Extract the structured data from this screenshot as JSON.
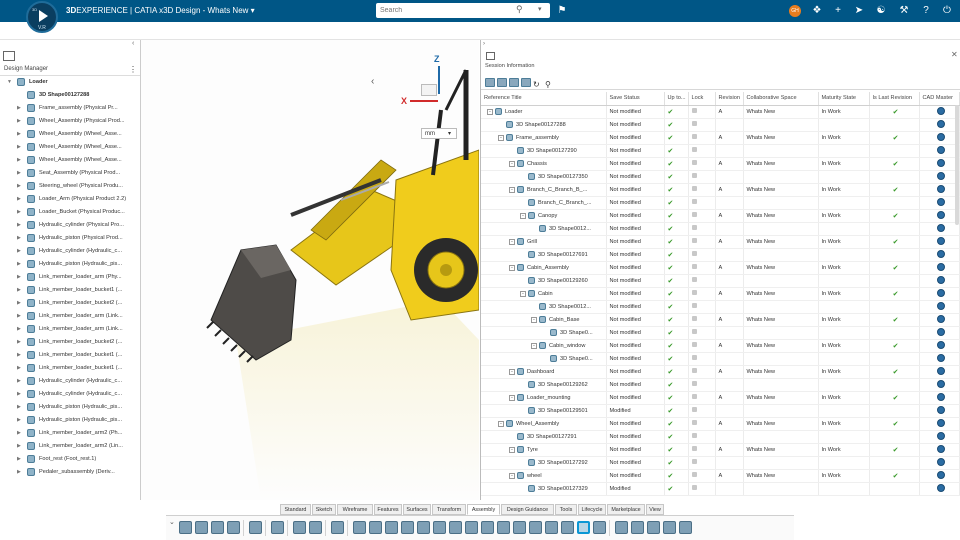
{
  "topbar": {
    "brand_bold": "3D",
    "brand_rest": "EXPERIENCE | CATIA  x3D Design - Whats New",
    "search_placeholder": "Search",
    "avatar_initials": "GH",
    "compass_version": "V.R",
    "compass_ds": "3D"
  },
  "design_manager": {
    "title": "Design Manager",
    "root": "Loader",
    "items": [
      "3D Shape00127288",
      "Frame_assembly (Physical Pr...",
      "Wheel_Assembly (Physical Prod...",
      "Wheel_Assembly (Wheel_Asse...",
      "Wheel_Assembly (Wheel_Asse...",
      "Wheel_Assembly (Wheel_Asse...",
      "Seat_Assembly (Physical Prod...",
      "Steering_wheel (Physical Produ...",
      "Loader_Arm (Physical Product 2.2)",
      "Loader_Bucket (Physical Produc...",
      "Hydraulic_cylinder (Physical Pro...",
      "Hydraulic_piston (Physical Prod...",
      "Hydraulic_cylinder (Hydraulic_c...",
      "Hydraulic_piston (Hydraulic_pis...",
      "Link_member_loader_arm (Phy...",
      "Link_member_loader_bucket1 (...",
      "Link_member_loader_bucket2 (...",
      "Link_member_loader_arm (Link...",
      "Link_member_loader_arm (Link...",
      "Link_member_loader_bucket2 (...",
      "Link_member_loader_bucket1 (...",
      "Link_member_loader_bucket1 (...",
      "Hydraulic_cylinder (Hydraulic_c...",
      "Hydraulic_cylinder (Hydraulic_c...",
      "Hydraulic_piston (Hydraulic_pis...",
      "Hydraulic_piston (Hydraulic_pis...",
      "Link_member_loader_arm2 (Ph...",
      "Link_member_loader_arm2 (Lin...",
      "Foot_rest (Foot_rest.1)",
      "Pedaler_subassembly (Deriv..."
    ]
  },
  "viewport": {
    "unit": "mm",
    "axis_x": "X",
    "axis_z": "Z"
  },
  "session": {
    "title": "Session Information",
    "columns": [
      "Reference Title",
      "Save Status",
      "Up to...",
      "Lock",
      "Revision",
      "Collaborative Space",
      "Maturity State",
      "Is Last Revision",
      "CAD Master"
    ],
    "rows": [
      {
        "t": "Loader",
        "d": 0,
        "e": "-",
        "s": "Not modified",
        "r": "A",
        "cs": "Whats New",
        "m": "In Work",
        "last": true
      },
      {
        "t": "3D Shape00127288",
        "d": 1,
        "e": "",
        "s": "Not modified",
        "r": "",
        "cs": "",
        "m": "",
        "last": false
      },
      {
        "t": "Frame_assembly",
        "d": 1,
        "e": "-",
        "s": "Not modified",
        "r": "A",
        "cs": "Whats New",
        "m": "In Work",
        "last": true
      },
      {
        "t": "3D Shape00127290",
        "d": 2,
        "e": "",
        "s": "Not modified",
        "r": "",
        "cs": "",
        "m": "",
        "last": false
      },
      {
        "t": "Chassis",
        "d": 2,
        "e": "-",
        "s": "Not modified",
        "r": "A",
        "cs": "Whats New",
        "m": "In Work",
        "last": true
      },
      {
        "t": "3D Shape00127350",
        "d": 3,
        "e": "",
        "s": "Not modified",
        "r": "",
        "cs": "",
        "m": "",
        "last": false
      },
      {
        "t": "Branch_C_Branch_B_...",
        "d": 2,
        "e": "-",
        "s": "Not modified",
        "r": "A",
        "cs": "Whats New",
        "m": "In Work",
        "last": true
      },
      {
        "t": "Branch_C_Branch_...",
        "d": 3,
        "e": "",
        "s": "Not modified",
        "r": "",
        "cs": "",
        "m": "",
        "last": false
      },
      {
        "t": "Canopy",
        "d": 3,
        "e": "-",
        "s": "Not modified",
        "r": "A",
        "cs": "Whats New",
        "m": "In Work",
        "last": true
      },
      {
        "t": "3D Shape0012...",
        "d": 4,
        "e": "",
        "s": "Not modified",
        "r": "",
        "cs": "",
        "m": "",
        "last": false
      },
      {
        "t": "Grill",
        "d": 2,
        "e": "-",
        "s": "Not modified",
        "r": "A",
        "cs": "Whats New",
        "m": "In Work",
        "last": true
      },
      {
        "t": "3D Shape00127691",
        "d": 3,
        "e": "",
        "s": "Not modified",
        "r": "",
        "cs": "",
        "m": "",
        "last": false
      },
      {
        "t": "Cabin_Assembly",
        "d": 2,
        "e": "-",
        "s": "Not modified",
        "r": "A",
        "cs": "Whats New",
        "m": "In Work",
        "last": true
      },
      {
        "t": "3D Shape00129260",
        "d": 3,
        "e": "",
        "s": "Not modified",
        "r": "",
        "cs": "",
        "m": "",
        "last": false
      },
      {
        "t": "Cabin",
        "d": 3,
        "e": "-",
        "s": "Not modified",
        "r": "A",
        "cs": "Whats New",
        "m": "In Work",
        "last": true
      },
      {
        "t": "3D Shape0012...",
        "d": 4,
        "e": "",
        "s": "Not modified",
        "r": "",
        "cs": "",
        "m": "",
        "last": false
      },
      {
        "t": "Cabin_Base",
        "d": 4,
        "e": "-",
        "s": "Not modified",
        "r": "A",
        "cs": "Whats New",
        "m": "In Work",
        "last": true
      },
      {
        "t": "3D Shape0...",
        "d": 5,
        "e": "",
        "s": "Not modified",
        "r": "",
        "cs": "",
        "m": "",
        "last": false
      },
      {
        "t": "Cabin_window",
        "d": 4,
        "e": "-",
        "s": "Not modified",
        "r": "A",
        "cs": "Whats New",
        "m": "In Work",
        "last": true
      },
      {
        "t": "3D Shape0...",
        "d": 5,
        "e": "",
        "s": "Not modified",
        "r": "",
        "cs": "",
        "m": "",
        "last": false
      },
      {
        "t": "Dashboard",
        "d": 2,
        "e": "-",
        "s": "Not modified",
        "r": "A",
        "cs": "Whats New",
        "m": "In Work",
        "last": true
      },
      {
        "t": "3D Shape00129262",
        "d": 3,
        "e": "",
        "s": "Not modified",
        "r": "",
        "cs": "",
        "m": "",
        "last": false
      },
      {
        "t": "Loader_mounting",
        "d": 2,
        "e": "-",
        "s": "Not modified",
        "r": "A",
        "cs": "Whats New",
        "m": "In Work",
        "last": true
      },
      {
        "t": "3D Shape00129501",
        "d": 3,
        "e": "",
        "s": "Modified",
        "r": "",
        "cs": "",
        "m": "",
        "last": false
      },
      {
        "t": "Wheel_Assembly",
        "d": 1,
        "e": "-",
        "s": "Not modified",
        "r": "A",
        "cs": "Whats New",
        "m": "In Work",
        "last": true
      },
      {
        "t": "3D Shape00127291",
        "d": 2,
        "e": "",
        "s": "Not modified",
        "r": "",
        "cs": "",
        "m": "",
        "last": false
      },
      {
        "t": "Tyre",
        "d": 2,
        "e": "-",
        "s": "Not modified",
        "r": "A",
        "cs": "Whats New",
        "m": "In Work",
        "last": true
      },
      {
        "t": "3D Shape00127292",
        "d": 3,
        "e": "",
        "s": "Not modified",
        "r": "",
        "cs": "",
        "m": "",
        "last": false
      },
      {
        "t": "wheel",
        "d": 2,
        "e": "-",
        "s": "Not modified",
        "r": "A",
        "cs": "Whats New",
        "m": "In Work",
        "last": true
      },
      {
        "t": "3D Shape00127329",
        "d": 3,
        "e": "",
        "s": "Modified",
        "r": "",
        "cs": "",
        "m": "",
        "last": false
      }
    ]
  },
  "tabs": [
    "Standard",
    "Sketch",
    "Wireframe",
    "Features",
    "Surfaces",
    "Transform",
    "Assembly",
    "Design Guidance",
    "Tools",
    "Lifecycle",
    "Marketplace",
    "View"
  ],
  "active_tab": "Assembly",
  "colors": {
    "topbar": "#005686",
    "highlight": "#0b97d4",
    "check": "#3a9a2b"
  }
}
